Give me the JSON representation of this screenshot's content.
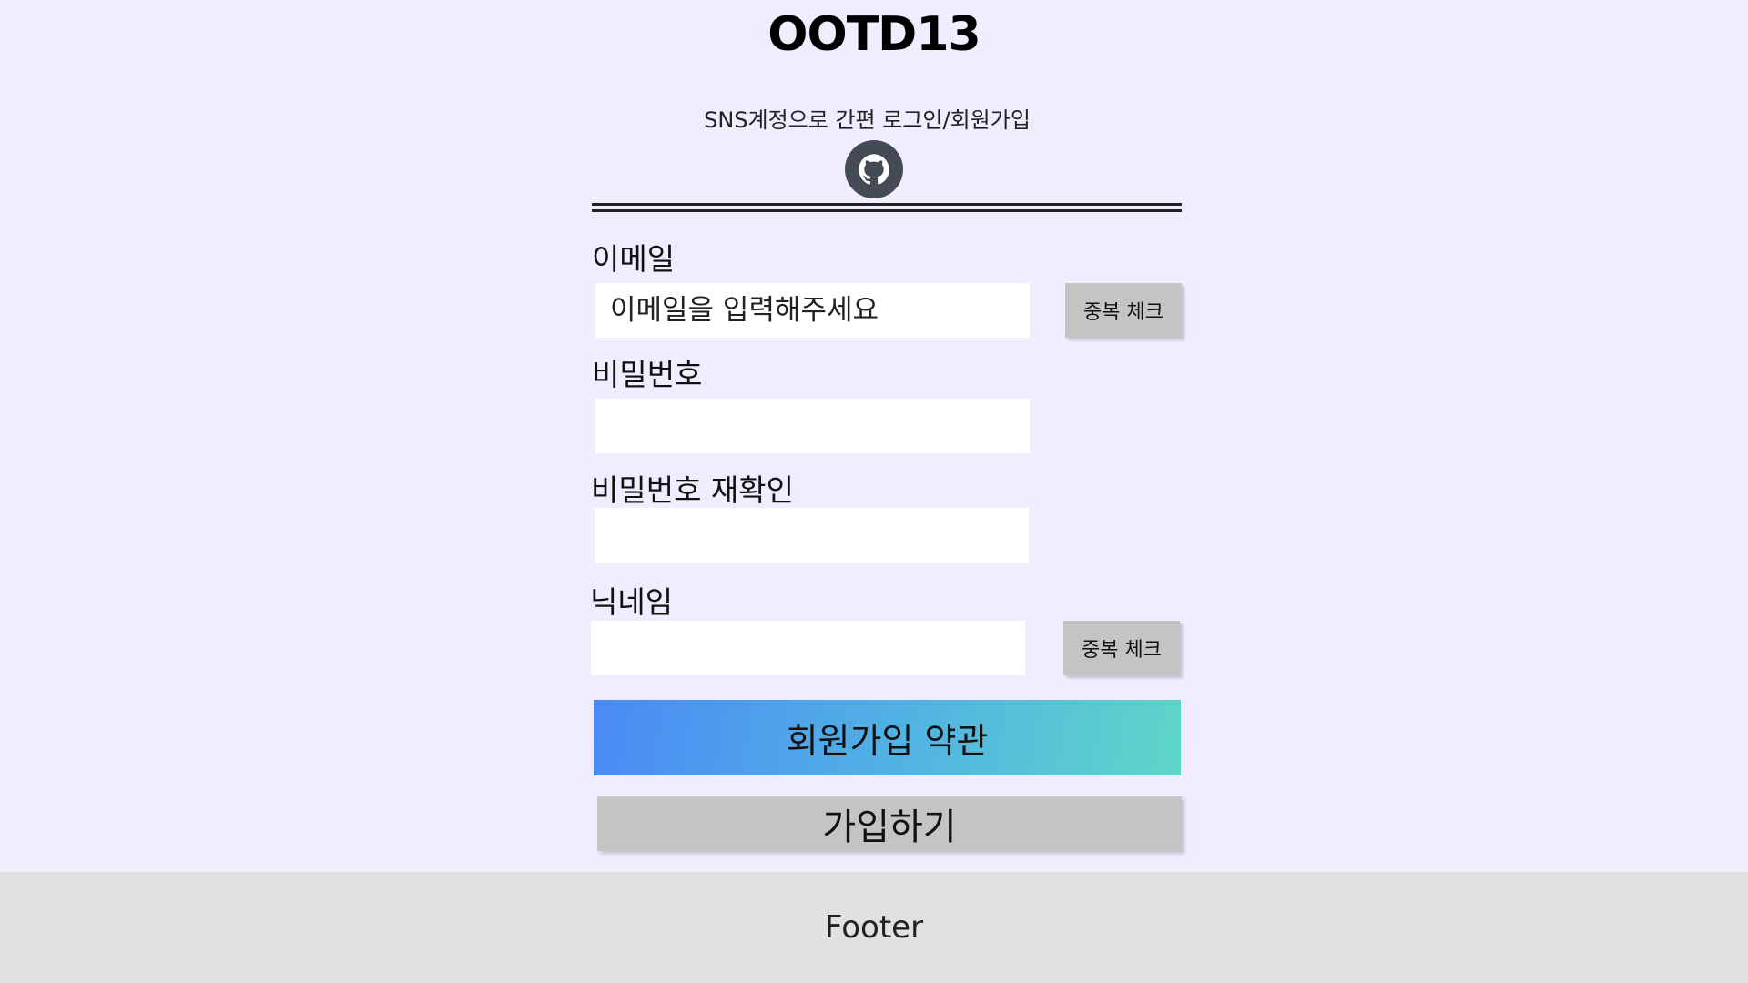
{
  "header": {
    "logo": "OOTD13"
  },
  "sns": {
    "label": "SNS계정으로 간편 로그인/회원가입",
    "github_icon": "github-icon"
  },
  "form": {
    "email": {
      "label": "이메일",
      "placeholder": "이메일을 입력해주세요",
      "value": "",
      "check_button": "중복 체크"
    },
    "password": {
      "label": "비밀번호",
      "value": ""
    },
    "password_confirm": {
      "label": "비밀번호 재확인",
      "value": ""
    },
    "nickname": {
      "label": "닉네임",
      "value": "",
      "check_button": "중복 체크"
    },
    "terms_button": "회원가입 약관",
    "submit_button": "가입하기"
  },
  "footer": {
    "text": "Footer"
  },
  "colors": {
    "background": "#f0eefe",
    "button_gray": "#c4c4c4",
    "gradient_start": "#4a8af5",
    "gradient_end": "#5ed6c8",
    "footer_bg": "#e1e1e1"
  }
}
